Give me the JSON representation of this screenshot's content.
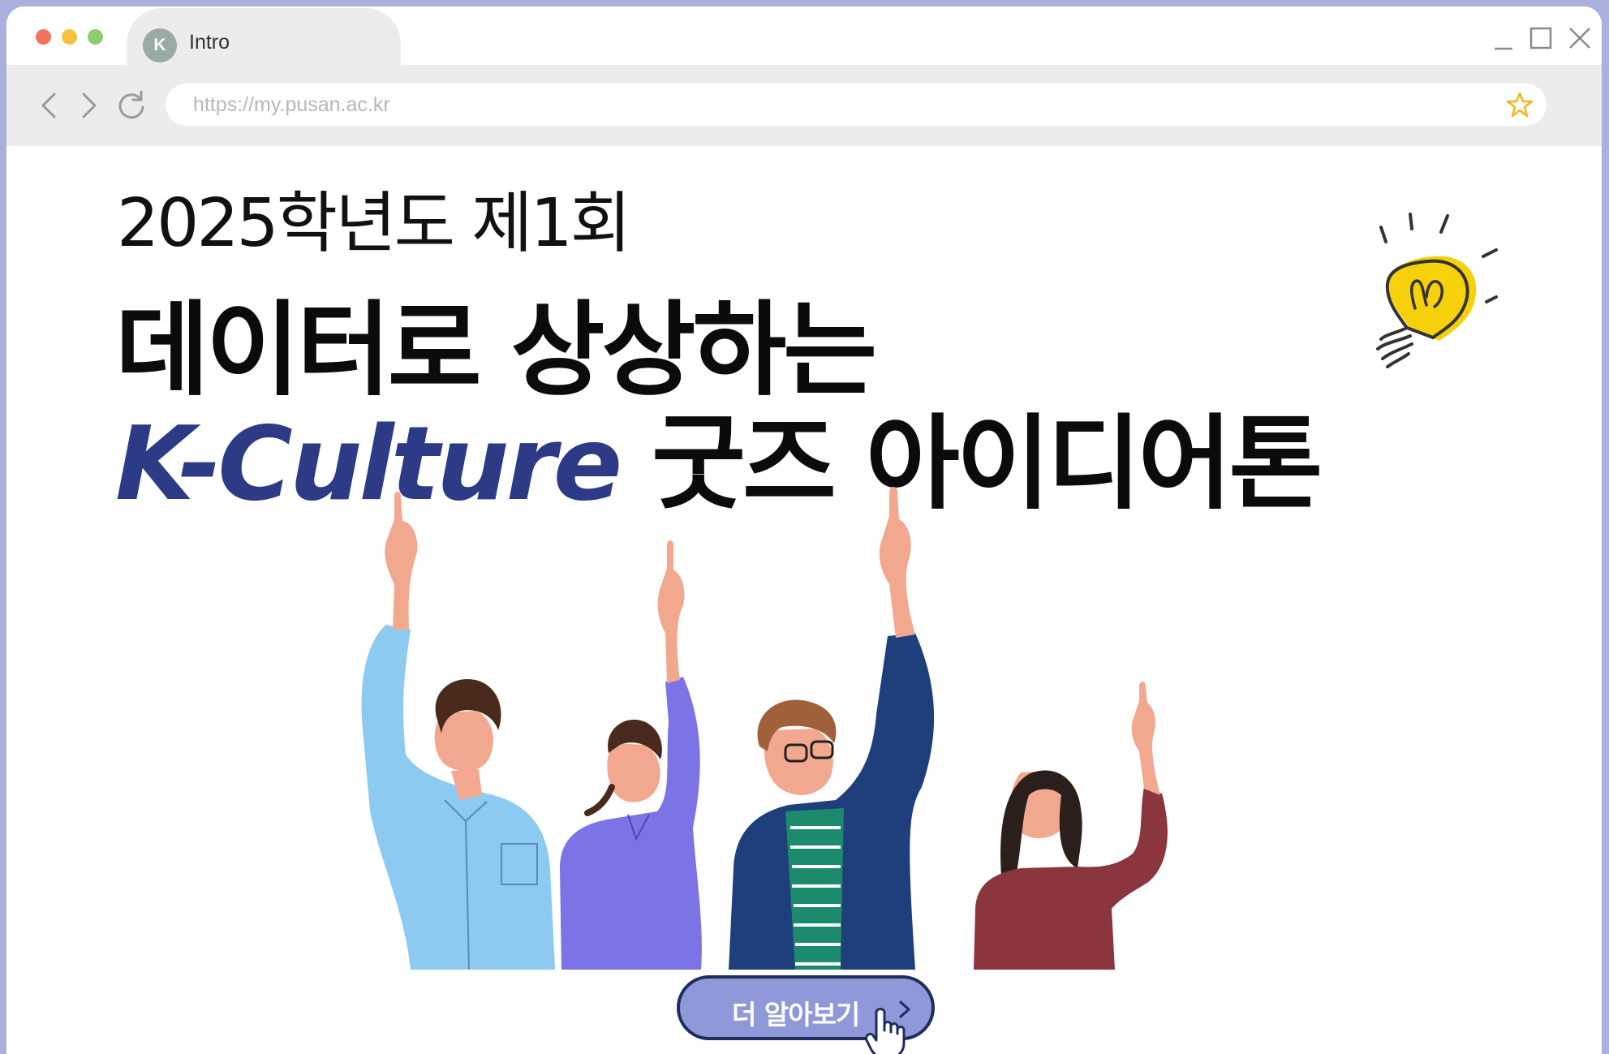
{
  "browser": {
    "window_controls": [
      "close",
      "minimize",
      "maximize"
    ],
    "dot_colors": [
      "#f2725e",
      "#f6c33b",
      "#8fcb6f"
    ],
    "tab": {
      "favicon_letter": "K",
      "title": "Intro"
    },
    "url": "https://my.pusan.ac.kr",
    "bookmark_icon": "star-icon",
    "nav_icons": [
      "back-arrow-icon",
      "forward-arrow-icon",
      "reload-icon"
    ],
    "win_icons": [
      "minimize-icon",
      "maximize-icon",
      "close-icon"
    ]
  },
  "hero": {
    "subtitle": "2025학년도 제1회",
    "headline_line1": "데이터로 상상하는",
    "headline_kculture": "K-Culture",
    "headline_rest": " 굿즈 아이디어톤",
    "accent_color": "#2d3a86"
  },
  "cta": {
    "label": "더 알아보기",
    "color": "#8f98d8"
  }
}
